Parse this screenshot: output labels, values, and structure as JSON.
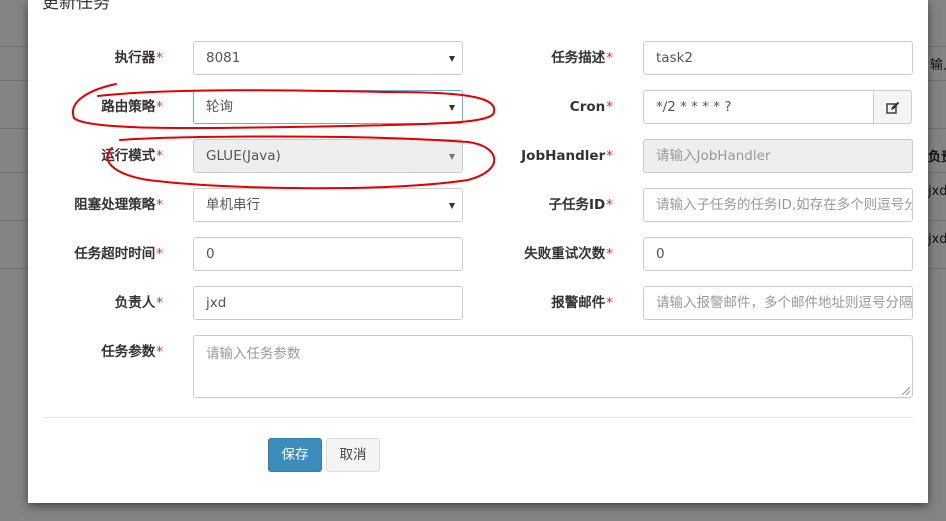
{
  "modal": {
    "title": "更新任务",
    "required_mark": "*",
    "fields_left": [
      {
        "label": "执行器",
        "value": "8081",
        "type": "select",
        "required": true
      },
      {
        "label": "路由策略",
        "value": "轮询",
        "type": "select",
        "required": true
      },
      {
        "label": "运行模式",
        "value": "GLUE(Java)",
        "type": "select",
        "required": true,
        "disabled": true
      },
      {
        "label": "阻塞处理策略",
        "value": "单机串行",
        "type": "select",
        "required": true
      },
      {
        "label": "任务超时时间",
        "value": "0",
        "type": "input",
        "required": true
      },
      {
        "label": "负责人",
        "value": "jxd",
        "type": "input",
        "required": true
      }
    ],
    "fields_right": [
      {
        "label": "任务描述",
        "value": "task2",
        "placeholder": "",
        "required": true
      },
      {
        "label": "Cron",
        "value": "*/2 * * * * ?",
        "placeholder": "",
        "required": true
      },
      {
        "label": "JobHandler",
        "value": "",
        "placeholder": "请输入JobHandler",
        "required": true,
        "disabled": true
      },
      {
        "label": "子任务ID",
        "value": "",
        "placeholder": "请输入子任务的任务ID,如存在多个则逗号分隔",
        "required": true
      },
      {
        "label": "失败重试次数",
        "value": "0",
        "placeholder": "",
        "required": true
      },
      {
        "label": "报警邮件",
        "value": "",
        "placeholder": "请输入报警邮件，多个邮件地址则逗号分隔",
        "required": true
      }
    ],
    "params": {
      "label": "任务参数",
      "placeholder": "请输入任务参数",
      "required": true
    },
    "buttons": {
      "save": "保存",
      "cancel": "取消"
    }
  },
  "background": {
    "right_texts": [
      "负责",
      "jxd",
      "jxd",
      "输入"
    ]
  },
  "colors": {
    "primary": "#3c8dbc",
    "required": "#e23333",
    "annotation": "#e00000"
  },
  "icons": {
    "cron_button": "edit-icon"
  }
}
